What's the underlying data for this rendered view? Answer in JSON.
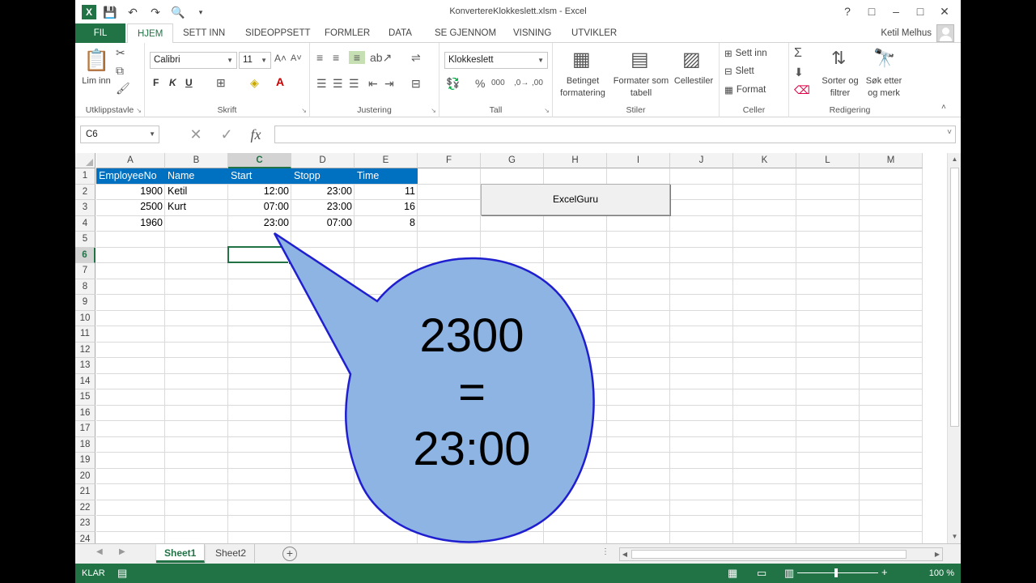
{
  "window": {
    "title": "KonvertereKlokkeslett.xlsm - Excel",
    "user": "Ketil Melhus",
    "controls": [
      "?",
      "□",
      "–",
      "□",
      "✕"
    ]
  },
  "ribbon_tabs": [
    "FIL",
    "HJEM",
    "SETT INN",
    "SIDEOPPSETT",
    "FORMLER",
    "DATA",
    "SE GJENNOM",
    "VISNING",
    "UTVIKLER"
  ],
  "active_tab": "HJEM",
  "ribbon": {
    "clipboard": {
      "label": "Utklippstavle",
      "paste_label": "Lim inn"
    },
    "font": {
      "label": "Skrift",
      "font_name": "Calibri",
      "font_size": "11",
      "bold": "F",
      "italic": "K",
      "underline": "U"
    },
    "alignment": {
      "label": "Justering"
    },
    "number": {
      "label": "Tall",
      "format": "Klokkeslett"
    },
    "styles": {
      "label": "Stiler",
      "conditional": "Betinget formatering",
      "format_table": "Formater som tabell",
      "cell_styles": "Cellestiler"
    },
    "cells": {
      "label": "Celler",
      "insert": "Sett inn",
      "delete": "Slett",
      "format": "Format"
    },
    "editing": {
      "label": "Redigering",
      "sort": "Sorter og filtrer",
      "find": "Søk etter og merk"
    }
  },
  "formula_bar": {
    "name_box": "C6",
    "formula": ""
  },
  "columns": [
    "A",
    "B",
    "C",
    "D",
    "E",
    "F",
    "G",
    "H",
    "I",
    "J",
    "K",
    "L",
    "M"
  ],
  "rows": [
    "1",
    "2",
    "3",
    "4",
    "5",
    "6",
    "7",
    "8",
    "9",
    "10",
    "11",
    "12",
    "13",
    "14",
    "15",
    "16",
    "17",
    "18",
    "19",
    "20",
    "21",
    "22",
    "23",
    "24"
  ],
  "selected_column": "C",
  "selected_row": "6",
  "table": {
    "headers": [
      "EmployeeNo",
      "Name",
      "Start",
      "Stopp",
      "Time"
    ],
    "rows": [
      [
        "1900",
        "Ketil",
        "12:00",
        "23:00",
        "11"
      ],
      [
        "2500",
        "Kurt",
        "07:00",
        "23:00",
        "16"
      ],
      [
        "1960",
        "",
        "23:00",
        "07:00",
        "8"
      ]
    ]
  },
  "macro_button": "ExcelGuru",
  "callout": {
    "line1": "2300",
    "line2": "=",
    "line3": "23:00"
  },
  "sheets": [
    "Sheet1",
    "Sheet2"
  ],
  "active_sheet": "Sheet1",
  "status": {
    "text": "KLAR",
    "zoom": "100 %"
  },
  "colors": {
    "excel_green": "#217346",
    "table_header": "#0070c0",
    "callout_fill": "#8eb4e3",
    "callout_stroke": "#1f1fcf"
  }
}
